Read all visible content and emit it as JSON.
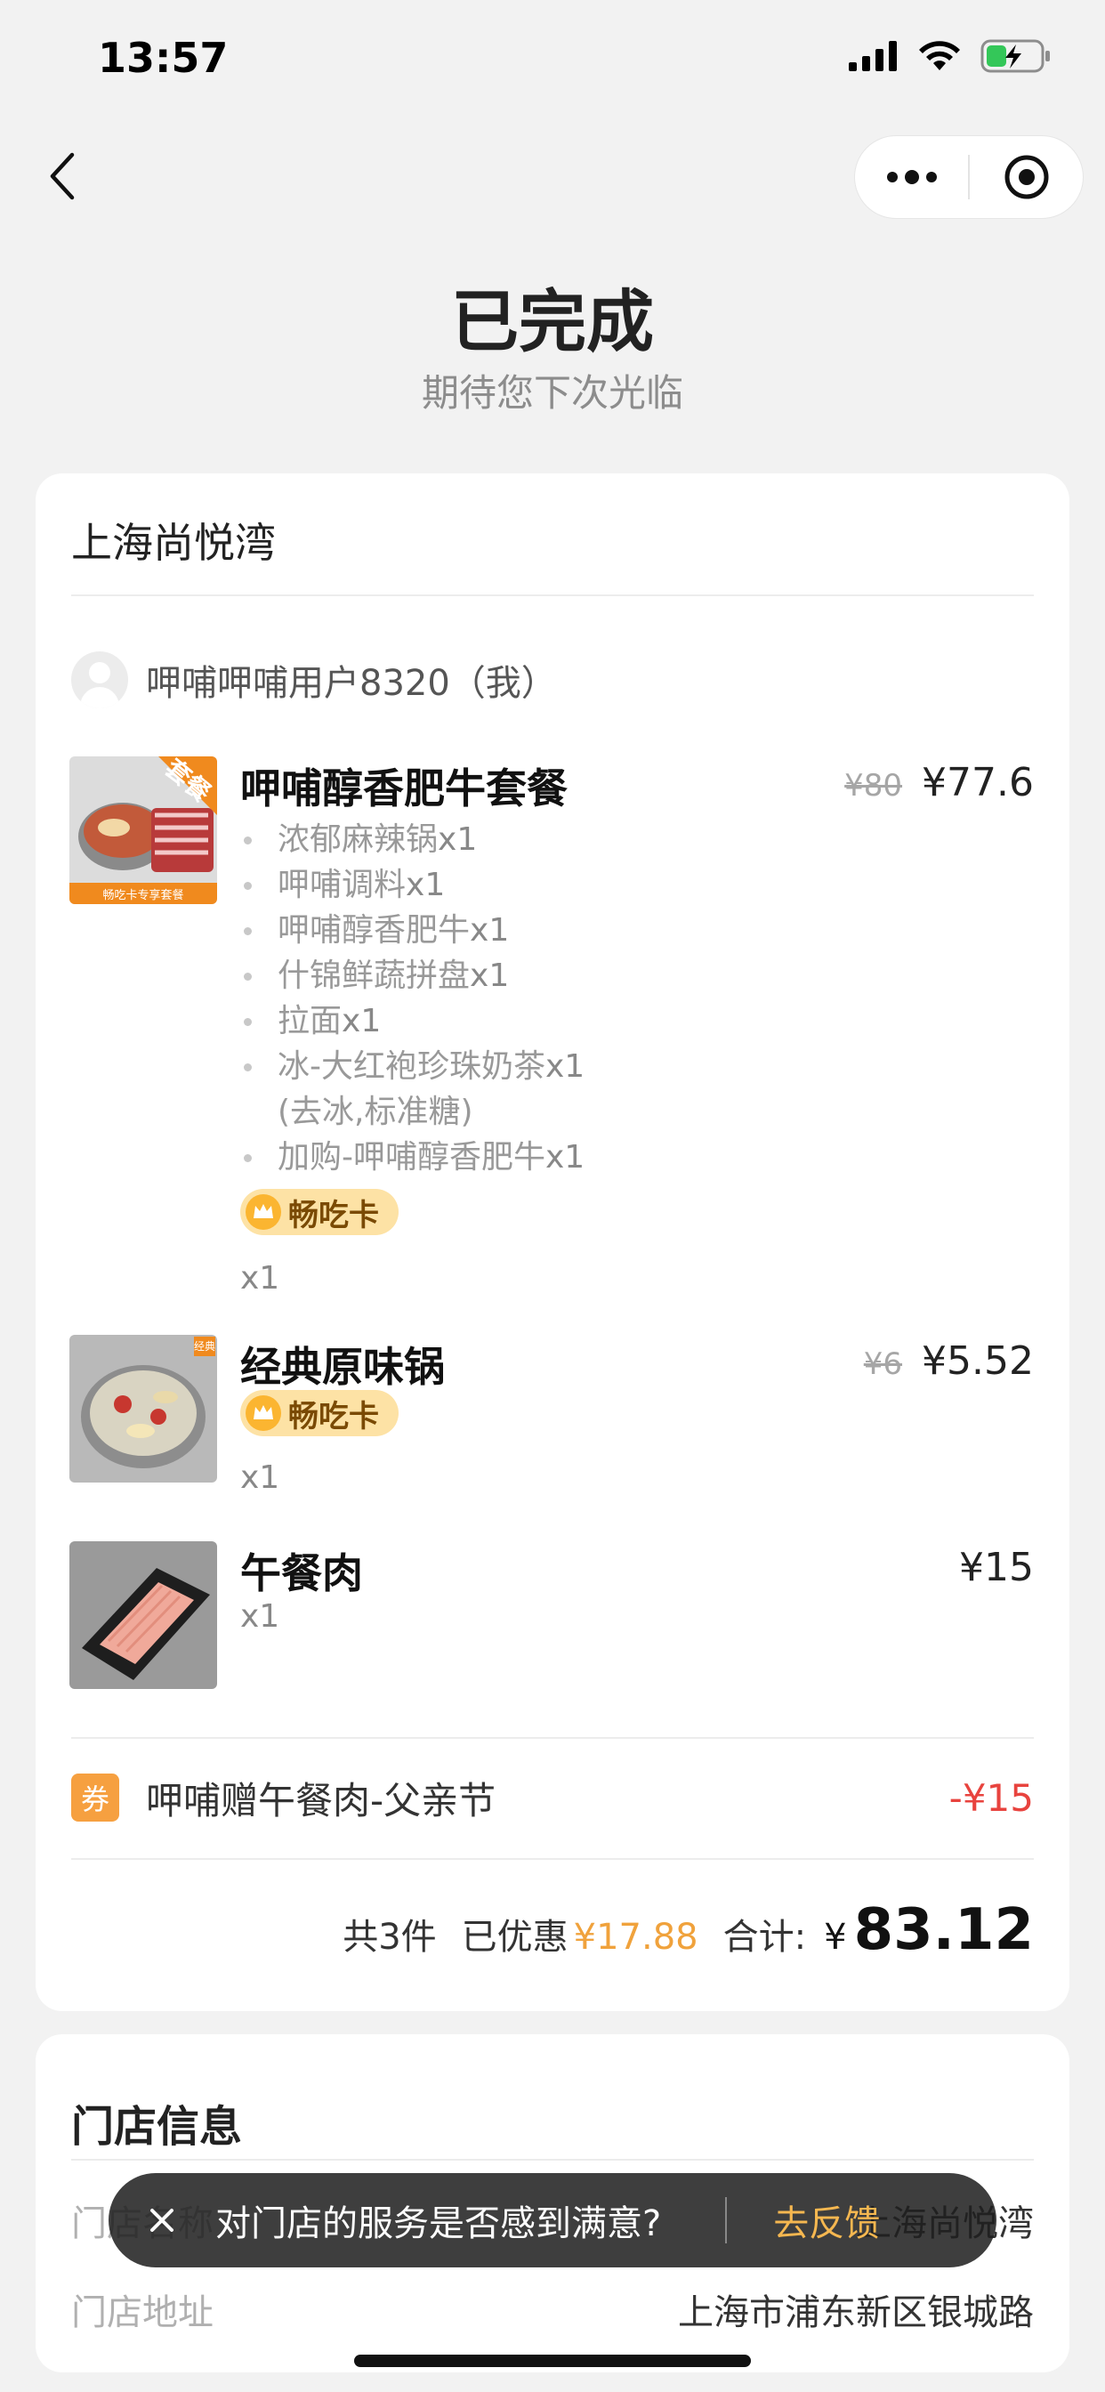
{
  "status_bar": {
    "time": "13:57"
  },
  "header": {
    "title": "已完成",
    "subtitle": "期待您下次光临"
  },
  "order": {
    "store_name": "上海尚悦湾",
    "user": "呷哺呷哺用户8320（我）",
    "items": [
      {
        "name": "呷哺醇香肥牛套餐",
        "old_price": "¥80",
        "price": "¥77.6",
        "image_tag": "套餐",
        "image_caption": "畅吃卡专享套餐",
        "sub_items": [
          {
            "name": "浓郁麻辣锅",
            "qty": "x1"
          },
          {
            "name": "呷哺调料",
            "qty": "x1"
          },
          {
            "name": "呷哺醇香肥牛",
            "qty": "x1"
          },
          {
            "name": "什锦鲜蔬拼盘",
            "qty": "x1"
          },
          {
            "name": "拉面",
            "qty": "x1"
          },
          {
            "name": "冰-大红袍珍珠奶茶",
            "qty": "x1",
            "note": "(去冰,标准糖)"
          },
          {
            "name": "加购-呷哺醇香肥牛",
            "qty": "x1"
          }
        ],
        "badge": "畅吃卡",
        "quantity": "x1"
      },
      {
        "name": "经典原味锅",
        "old_price": "¥6",
        "price": "¥5.52",
        "image_tag": "经典",
        "badge": "畅吃卡",
        "quantity": "x1"
      },
      {
        "name": "午餐肉",
        "price": "¥15",
        "quantity": "x1"
      }
    ],
    "coupon": {
      "tag": "券",
      "label": "呷哺赠午餐肉-父亲节",
      "amount": "-¥15"
    },
    "summary": {
      "count": "共3件",
      "discount_label": "已优惠",
      "discount": "¥17.88",
      "total_label": "合计:",
      "currency": "¥",
      "total": "83.12"
    }
  },
  "store_info": {
    "title": "门店信息",
    "name_label": "门店名称",
    "name_value": "上海尚悦湾",
    "address_label": "门店地址",
    "address_value": "上海市浦东新区银城路"
  },
  "toast": {
    "message": "对门店的服务是否感到满意?",
    "action": "去反馈"
  },
  "colors": {
    "accent_orange": "#f0a23c",
    "discount_red": "#e8433e",
    "badge_bg": "#fde2a5"
  }
}
